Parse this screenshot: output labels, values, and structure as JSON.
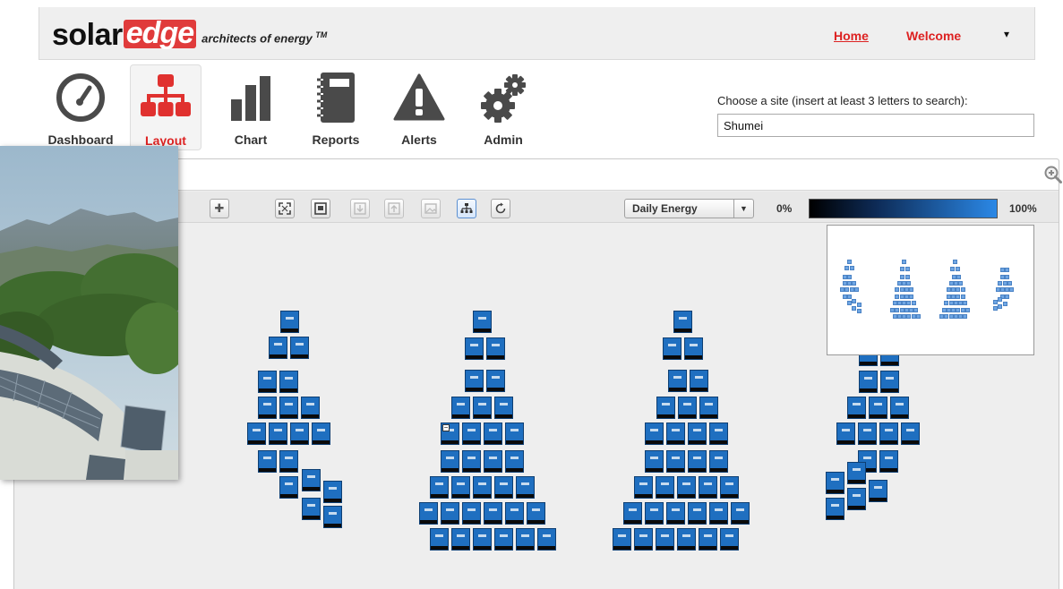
{
  "header": {
    "logo_solar": "solar",
    "logo_edge": "edge",
    "logo_tagline": "architects of energy",
    "logo_tm": "TM",
    "home_link": "Home",
    "welcome_label": "Welcome",
    "user_menu_caret": "▾"
  },
  "toolbar": {
    "tools": [
      {
        "label": "Dashboard",
        "icon": "gauge-icon"
      },
      {
        "label": "Layout",
        "icon": "layout-tree-icon",
        "active": true
      },
      {
        "label": "Chart",
        "icon": "bar-chart-icon"
      },
      {
        "label": "Reports",
        "icon": "notebook-icon"
      },
      {
        "label": "Alerts",
        "icon": "warning-icon"
      },
      {
        "label": "Admin",
        "icon": "gears-icon"
      }
    ]
  },
  "site_search": {
    "label": "Choose a site (insert at least 3 letters to search):",
    "value": "Shumei"
  },
  "layout_toolbar": {
    "metric_select": "Daily Energy",
    "scale_min": "0%",
    "scale_max": "100%"
  },
  "colors": {
    "brand_red": "#e03b3b",
    "module_blue": "#1f6fc0",
    "nav_red": "#dd2222"
  }
}
